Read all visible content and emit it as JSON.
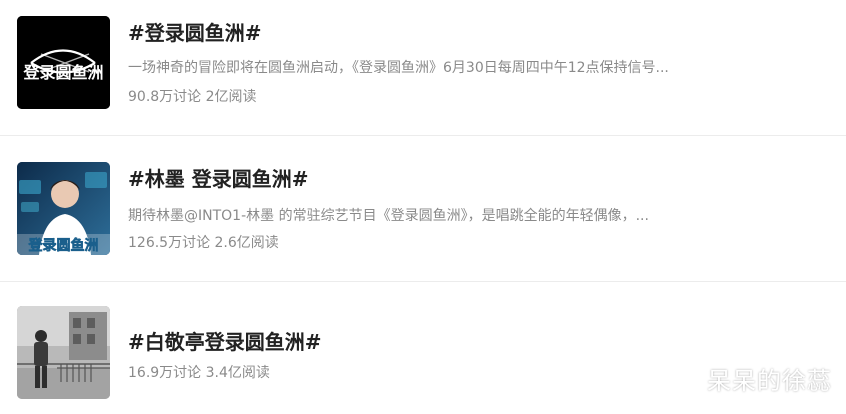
{
  "topics": [
    {
      "title": "#登录圆鱼洲#",
      "description": "一场神奇的冒险即将在圆鱼洲启动，《登录圆鱼洲》6月30日每周四中午12点保持信号...",
      "stats": "90.8万讨论 2亿阅读",
      "thumb_text": "登录圆鱼洲",
      "thumb_icon": "fish-logo-icon"
    },
    {
      "title": "#林墨 登录圆鱼洲#",
      "description": "期待林墨@INTO1-林墨 的常驻综艺节目《登录圆鱼洲》，是唱跳全能的年轻偶像，...",
      "stats": "126.5万讨论 2.6亿阅读",
      "thumb_text": "登录圆鱼洲",
      "thumb_icon": "person-photo"
    },
    {
      "title": "#白敬亭登录圆鱼洲#",
      "description": "",
      "stats": "16.9万讨论 3.4亿阅读",
      "thumb_text": "",
      "thumb_icon": "street-photo"
    }
  ],
  "watermark": "呆呆的徐蕊",
  "colors": {
    "title": "#222222",
    "secondary": "#8a8a8a",
    "divider": "#ececec"
  }
}
